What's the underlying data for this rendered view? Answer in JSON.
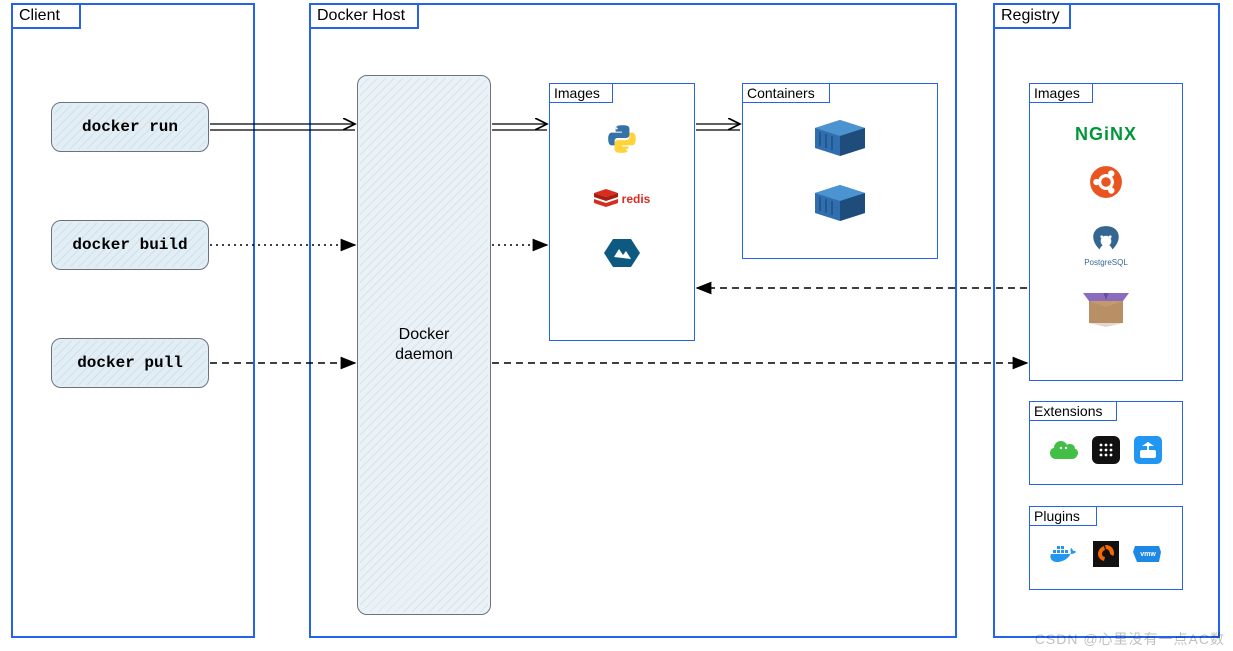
{
  "client": {
    "title": "Client",
    "commands": {
      "run": "docker run",
      "build": "docker build",
      "pull": "docker pull"
    }
  },
  "host": {
    "title": "Docker Host",
    "daemon": "Docker\ndaemon",
    "images_title": "Images",
    "containers_title": "Containers",
    "images": [
      "python",
      "redis",
      "alpine"
    ],
    "containers": [
      "container-1",
      "container-2"
    ]
  },
  "registry": {
    "title": "Registry",
    "images_title": "Images",
    "images": [
      "NGINX",
      "ubuntu",
      "PostgreSQL",
      "package"
    ],
    "extensions_title": "Extensions",
    "extensions": [
      "jfrog",
      "grid-app",
      "portainer"
    ],
    "plugins_title": "Plugins",
    "plugins": [
      "docker-whale",
      "grafana",
      "vmware"
    ]
  },
  "watermark": "CSDN @心里没有一点AC数"
}
